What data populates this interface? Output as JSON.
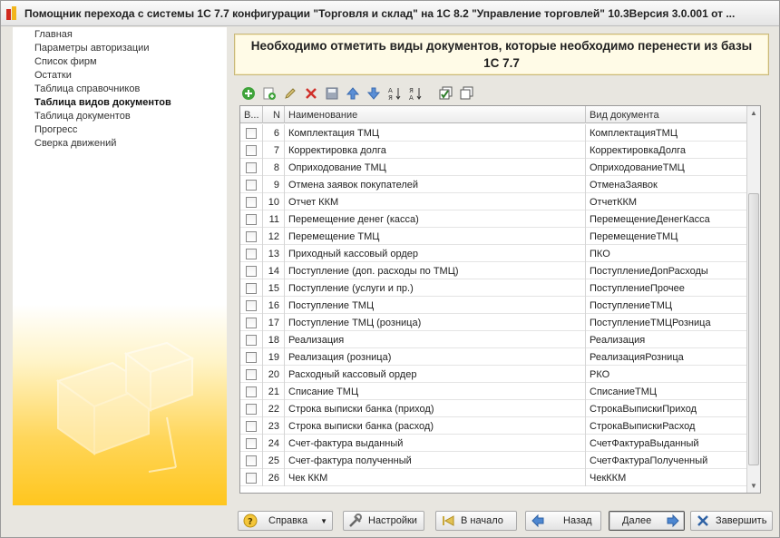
{
  "window": {
    "title": "Помощник перехода с системы 1С 7.7 конфигурации \"Торговля и склад\" на 1С 8.2 \"Управление торговлей\" 10.3Версия 3.0.001 от ..."
  },
  "sidebar": {
    "items": [
      {
        "label": "Главная",
        "active": false
      },
      {
        "label": "Параметры авторизации",
        "active": false
      },
      {
        "label": "Список фирм",
        "active": false
      },
      {
        "label": "Остатки",
        "active": false
      },
      {
        "label": "Таблица справочников",
        "active": false
      },
      {
        "label": "Таблица видов документов",
        "active": true
      },
      {
        "label": "Таблица документов",
        "active": false
      },
      {
        "label": "Прогресс",
        "active": false
      },
      {
        "label": "Сверка движений",
        "active": false
      }
    ]
  },
  "header": {
    "text": "Необходимо отметить виды документов, которые необходимо перенести из базы 1С 7.7"
  },
  "toolbar": {
    "icons": [
      "add-icon",
      "copy-icon",
      "edit-icon",
      "delete-icon",
      "save-icon",
      "move-up-icon",
      "move-down-icon",
      "sort-asc-icon",
      "sort-desc-icon",
      "check-all-icon",
      "uncheck-all-icon"
    ]
  },
  "table": {
    "headers": {
      "check": "В...",
      "n": "N",
      "name": "Наименование",
      "type": "Вид документа"
    },
    "rows": [
      {
        "n": "6",
        "name": "Комплектация ТМЦ",
        "type": "КомплектацияТМЦ",
        "checked": false
      },
      {
        "n": "7",
        "name": "Корректировка долга",
        "type": "КорректировкаДолга",
        "checked": false
      },
      {
        "n": "8",
        "name": "Оприходование ТМЦ",
        "type": "ОприходованиеТМЦ",
        "checked": false
      },
      {
        "n": "9",
        "name": "Отмена заявок покупателей",
        "type": "ОтменаЗаявок",
        "checked": false
      },
      {
        "n": "10",
        "name": "Отчет ККМ",
        "type": "ОтчетККМ",
        "checked": false
      },
      {
        "n": "11",
        "name": "Перемещение денег (касса)",
        "type": "ПеремещениеДенегКасса",
        "checked": false
      },
      {
        "n": "12",
        "name": "Перемещение ТМЦ",
        "type": "ПеремещениеТМЦ",
        "checked": false
      },
      {
        "n": "13",
        "name": "Приходный кассовый ордер",
        "type": "ПКО",
        "checked": false
      },
      {
        "n": "14",
        "name": "Поступление (доп. расходы по ТМЦ)",
        "type": "ПоступлениеДопРасходы",
        "checked": false
      },
      {
        "n": "15",
        "name": "Поступление (услуги и пр.)",
        "type": "ПоступлениеПрочее",
        "checked": false
      },
      {
        "n": "16",
        "name": "Поступление ТМЦ",
        "type": "ПоступлениеТМЦ",
        "checked": false
      },
      {
        "n": "17",
        "name": "Поступление ТМЦ (розница)",
        "type": "ПоступлениеТМЦРозница",
        "checked": false
      },
      {
        "n": "18",
        "name": "Реализация",
        "type": "Реализация",
        "checked": false
      },
      {
        "n": "19",
        "name": "Реализация (розница)",
        "type": "РеализацияРозница",
        "checked": false
      },
      {
        "n": "20",
        "name": "Расходный кассовый ордер",
        "type": "РКО",
        "checked": false
      },
      {
        "n": "21",
        "name": "Списание ТМЦ",
        "type": "СписаниеТМЦ",
        "checked": false
      },
      {
        "n": "22",
        "name": "Строка выписки банка (приход)",
        "type": "СтрокаВыпискиПриход",
        "checked": false
      },
      {
        "n": "23",
        "name": "Строка выписки банка (расход)",
        "type": "СтрокаВыпискиРасход",
        "checked": false
      },
      {
        "n": "24",
        "name": "Счет-фактура выданный",
        "type": "СчетФактураВыданный",
        "checked": false
      },
      {
        "n": "25",
        "name": "Счет-фактура полученный",
        "type": "СчетФактураПолученный",
        "checked": false
      },
      {
        "n": "26",
        "name": "Чек ККМ",
        "type": "ЧекККМ",
        "checked": false
      }
    ]
  },
  "buttons": {
    "help": "Справка",
    "settings": "Настройки",
    "to_start": "В начало",
    "back": "Назад",
    "next": "Далее",
    "finish": "Завершить"
  }
}
